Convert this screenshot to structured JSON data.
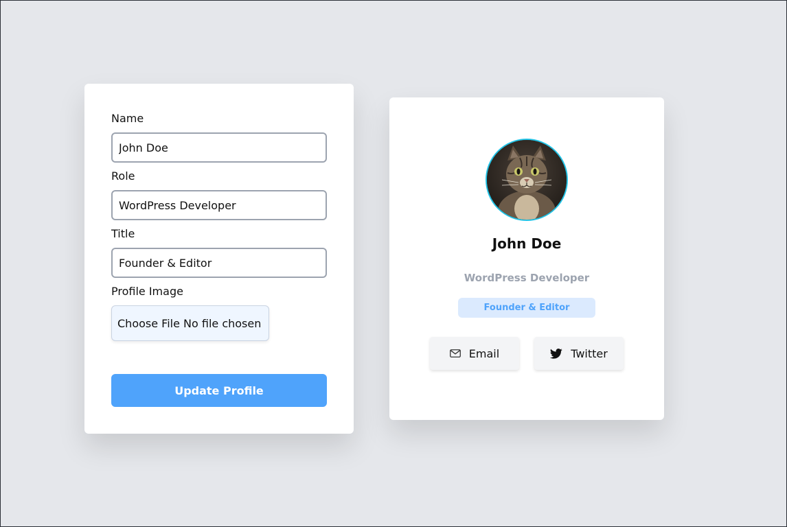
{
  "form": {
    "name_label": "Name",
    "name_value": "John Doe",
    "role_label": "Role",
    "role_value": "WordPress Developer",
    "title_label": "Title",
    "title_value": "Founder & Editor",
    "image_label": "Profile Image",
    "file_input_text": "Choose File No file chosen",
    "submit_label": "Update Profile"
  },
  "profile": {
    "avatar_icon": "cat-photo",
    "name": "John Doe",
    "role": "WordPress Developer",
    "title": "Founder & Editor",
    "email_label": "Email",
    "email_icon": "mail-icon",
    "twitter_label": "Twitter",
    "twitter_icon": "twitter-icon"
  },
  "colors": {
    "background": "#e5e7eb",
    "accent": "#4fa3fb",
    "badge_bg": "#dbeafe",
    "avatar_ring": "#22c3e6",
    "muted_text": "#9ca3af"
  }
}
